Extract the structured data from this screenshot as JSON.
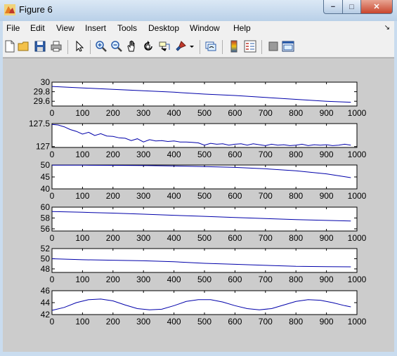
{
  "window": {
    "title": "Figure 6"
  },
  "window_controls": {
    "minimize": "−",
    "maximize": "□",
    "close": "✕"
  },
  "menubar": {
    "items": [
      "File",
      "Edit",
      "View",
      "Insert",
      "Tools",
      "Desktop",
      "Window",
      "Help"
    ],
    "overflow_arrow": "↘"
  },
  "toolbar": {
    "icons": [
      "new-figure-icon",
      "open-file-icon",
      "save-icon",
      "print-icon",
      "pointer-icon",
      "zoom-in-icon",
      "zoom-out-icon",
      "pan-hand-icon",
      "rotate-3d-icon",
      "data-cursor-icon",
      "brush-icon",
      "brush-dropdown-icon",
      "link-plot-icon",
      "colorbar-icon",
      "legend-icon",
      "hide-plot-tools-icon",
      "show-plot-tools-icon"
    ]
  },
  "colors": {
    "line": "#0000aa",
    "figure_bg": "#cccccc",
    "axes_bg": "#ffffff"
  },
  "chart_data": [
    {
      "type": "line",
      "xlim": [
        0,
        1000
      ],
      "ylim": [
        29.5,
        30
      ],
      "xticks": [
        0,
        100,
        200,
        300,
        400,
        500,
        600,
        700,
        800,
        900,
        1000
      ],
      "yticks": [
        29.6,
        29.8,
        30
      ],
      "ytick_labels": [
        "29.6",
        "29.8",
        "30"
      ],
      "x": [
        0,
        100,
        200,
        300,
        400,
        500,
        600,
        700,
        800,
        900,
        980
      ],
      "y": [
        29.91,
        29.88,
        29.85,
        29.82,
        29.79,
        29.75,
        29.72,
        29.68,
        29.64,
        29.6,
        29.58
      ]
    },
    {
      "type": "line",
      "xlim": [
        0,
        1000
      ],
      "ylim": [
        126.98,
        127.5
      ],
      "xticks": [
        0,
        100,
        200,
        300,
        400,
        500,
        600,
        700,
        800,
        900,
        1000
      ],
      "yticks": [
        127,
        127.5
      ],
      "ytick_labels": [
        "127",
        "127.5"
      ],
      "x": [
        0,
        20,
        40,
        60,
        80,
        100,
        120,
        140,
        160,
        180,
        200,
        220,
        240,
        260,
        280,
        300,
        320,
        340,
        360,
        380,
        400,
        420,
        440,
        460,
        480,
        500,
        520,
        540,
        560,
        580,
        600,
        620,
        640,
        660,
        680,
        700,
        720,
        740,
        760,
        780,
        800,
        820,
        840,
        860,
        880,
        900,
        920,
        940,
        960,
        980
      ],
      "y": [
        127.48,
        127.47,
        127.43,
        127.37,
        127.33,
        127.27,
        127.31,
        127.24,
        127.28,
        127.23,
        127.22,
        127.19,
        127.18,
        127.13,
        127.17,
        127.1,
        127.15,
        127.12,
        127.13,
        127.11,
        127.12,
        127.1,
        127.1,
        127.09,
        127.08,
        127.03,
        127.07,
        127.05,
        127.06,
        127.03,
        127.05,
        127.06,
        127.03,
        127.06,
        127.04,
        127.02,
        127.05,
        127.03,
        127.04,
        127.02,
        127.03,
        127.05,
        127.02,
        127.04,
        127.03,
        127.04,
        127.02,
        127.03,
        127.05,
        127.03
      ]
    },
    {
      "type": "line",
      "xlim": [
        0,
        1000
      ],
      "ylim": [
        40,
        50
      ],
      "xticks": [
        0,
        100,
        200,
        300,
        400,
        500,
        600,
        700,
        800,
        900,
        1000
      ],
      "yticks": [
        40,
        45,
        50
      ],
      "ytick_labels": [
        "40",
        "45",
        "50"
      ],
      "x": [
        0,
        100,
        200,
        300,
        400,
        500,
        600,
        700,
        800,
        900,
        980
      ],
      "y": [
        49.9,
        49.9,
        49.85,
        49.75,
        49.6,
        49.35,
        49.0,
        48.4,
        47.6,
        46.3,
        44.7
      ]
    },
    {
      "type": "line",
      "xlim": [
        0,
        1000
      ],
      "ylim": [
        55.6,
        60
      ],
      "xticks": [
        0,
        100,
        200,
        300,
        400,
        500,
        600,
        700,
        800,
        900,
        1000
      ],
      "yticks": [
        56,
        58,
        60
      ],
      "ytick_labels": [
        "56",
        "58",
        "60"
      ],
      "x": [
        0,
        100,
        200,
        300,
        400,
        500,
        600,
        700,
        800,
        900,
        980
      ],
      "y": [
        59.2,
        59.05,
        58.9,
        58.7,
        58.5,
        58.3,
        58.1,
        57.9,
        57.7,
        57.55,
        57.45
      ]
    },
    {
      "type": "line",
      "xlim": [
        0,
        1000
      ],
      "ylim": [
        47.3,
        52
      ],
      "xticks": [
        0,
        100,
        200,
        300,
        400,
        500,
        600,
        700,
        800,
        900,
        1000
      ],
      "yticks": [
        48,
        50,
        52
      ],
      "ytick_labels": [
        "48",
        "50",
        "52"
      ],
      "x": [
        0,
        100,
        200,
        300,
        400,
        500,
        600,
        700,
        800,
        900,
        980
      ],
      "y": [
        50.0,
        49.8,
        49.7,
        49.6,
        49.4,
        49.1,
        48.9,
        48.7,
        48.5,
        48.45,
        48.4
      ]
    },
    {
      "type": "line",
      "xlim": [
        0,
        1000
      ],
      "ylim": [
        42,
        46
      ],
      "xticks": [
        0,
        100,
        200,
        300,
        400,
        500,
        600,
        700,
        800,
        900,
        1000
      ],
      "yticks": [
        42,
        44,
        46
      ],
      "ytick_labels": [
        "42",
        "44",
        "46"
      ],
      "x": [
        0,
        40,
        80,
        120,
        160,
        200,
        240,
        280,
        320,
        360,
        400,
        440,
        480,
        520,
        560,
        600,
        640,
        680,
        720,
        760,
        800,
        840,
        880,
        920,
        960,
        980
      ],
      "y": [
        42.7,
        43.2,
        44.0,
        44.5,
        44.6,
        44.3,
        43.6,
        43.0,
        42.8,
        42.9,
        43.5,
        44.2,
        44.5,
        44.5,
        44.1,
        43.5,
        43.0,
        42.8,
        43.0,
        43.6,
        44.2,
        44.5,
        44.4,
        44.0,
        43.5,
        43.3
      ]
    }
  ]
}
